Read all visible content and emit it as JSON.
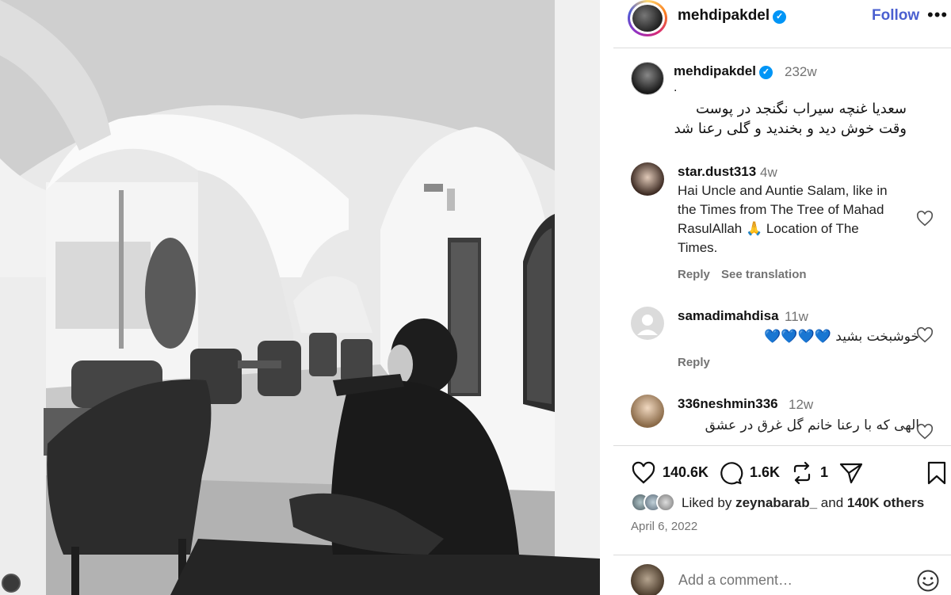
{
  "post": {
    "username": "mehdipakdel",
    "follow_label": "Follow",
    "more_label": "•••",
    "caption": {
      "time": "232w",
      "dot": ".",
      "line1": "سعدیا غنچه سیراب نگنجد در پوست",
      "line2": "وقت خوش دید و بخندید و گلی رعنا شد"
    },
    "comments": [
      {
        "user": "star.dust313",
        "time": "4w",
        "text_lines": [
          "Hai Uncle and Auntie Salam, like in",
          "the Times from The Tree of Mahad",
          "RasulAllah 🙏 Location of The",
          "Times."
        ],
        "reply": "Reply",
        "see_translation": "See translation"
      },
      {
        "user": "samadimahdisa",
        "time": "11w",
        "text": "خوشبخت بشید 💙💙💙💙",
        "reply": "Reply"
      },
      {
        "user": "336neshmin336",
        "time": "12w",
        "text": "الهی که با رعنا خانم گل غرق در عشق"
      }
    ],
    "likes_count": "140.6K",
    "comments_count": "1.6K",
    "reposts_count": "1",
    "liked_by_prefix": "Liked by",
    "liked_by_user": "zeynabarab_",
    "liked_by_and": "and",
    "liked_by_others": "140K others",
    "date": "April 6, 2022",
    "add_comment_placeholder": "Add a comment…"
  },
  "colors": {
    "follow_blue": "#4a5fd0",
    "verified_blue": "#0095f6",
    "muted_gray": "#737373"
  },
  "icons": [
    "verified-badge-icon",
    "heart-icon",
    "comment-icon",
    "repost-icon",
    "share-icon",
    "bookmark-icon",
    "emoji-icon"
  ]
}
